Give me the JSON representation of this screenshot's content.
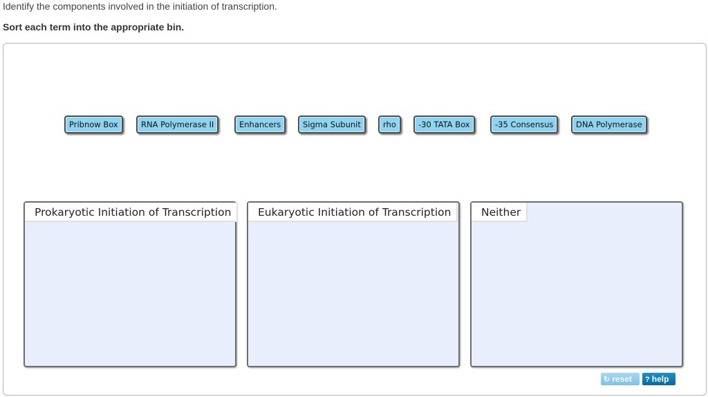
{
  "instructions": {
    "line1": "Identify the components involved in the initiation of transcription.",
    "line2": "Sort each term into the appropriate bin."
  },
  "terms": [
    "Pribnow Box",
    "RNA Polymerase II",
    "Enhancers",
    "Sigma Subunit",
    "rho",
    "-30 TATA Box",
    "-35 Consensus",
    "DNA Polymerase"
  ],
  "bins": [
    {
      "label": "Prokaryotic Initiation of Transcription"
    },
    {
      "label": "Eukaryotic Initiation of Transcription"
    },
    {
      "label": "Neither"
    }
  ],
  "controls": {
    "reset_label": "reset",
    "reset_icon": "reset-icon",
    "help_label": "help",
    "help_icon": "question-icon"
  },
  "colors": {
    "term_bg": "#8ed3f0",
    "bin_bg": "#e8eefc",
    "help_bg": "#0a6a9c"
  }
}
